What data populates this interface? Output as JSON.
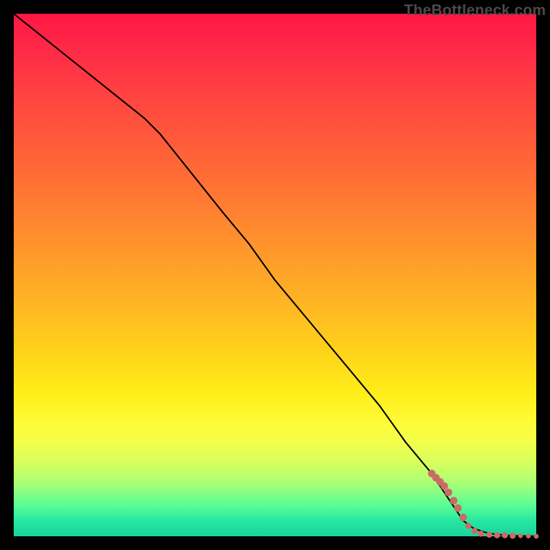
{
  "watermark": "TheBottleneck.com",
  "colors": {
    "frame": "#000000",
    "curve": "#000000",
    "dot": "#cc6b66"
  },
  "chart_data": {
    "type": "line",
    "title": "",
    "xlabel": "",
    "ylabel": "",
    "xlim": [
      0,
      100
    ],
    "ylim": [
      0,
      100
    ],
    "grid": false,
    "legend": false,
    "series": [
      {
        "name": "curve",
        "x": [
          0,
          5,
          10,
          15,
          20,
          25,
          28,
          32,
          36,
          40,
          45,
          50,
          55,
          60,
          65,
          70,
          75,
          80,
          84,
          86,
          88,
          90,
          92,
          94,
          96,
          98,
          100
        ],
        "y": [
          100,
          96,
          92,
          88,
          84,
          80,
          77,
          72,
          67,
          62,
          56,
          49,
          43,
          37,
          31,
          25,
          18,
          12,
          6,
          3,
          1.5,
          0.8,
          0.4,
          0.2,
          0.1,
          0.05,
          0
        ]
      }
    ],
    "scatter": {
      "name": "dots",
      "points": [
        {
          "x": 80.0,
          "y": 12.0,
          "r": 5
        },
        {
          "x": 80.8,
          "y": 11.2,
          "r": 5
        },
        {
          "x": 81.6,
          "y": 10.4,
          "r": 5
        },
        {
          "x": 82.4,
          "y": 9.6,
          "r": 5
        },
        {
          "x": 83.2,
          "y": 8.4,
          "r": 5
        },
        {
          "x": 84.2,
          "y": 6.8,
          "r": 5
        },
        {
          "x": 85.0,
          "y": 5.4,
          "r": 5
        },
        {
          "x": 86.0,
          "y": 3.6,
          "r": 5
        },
        {
          "x": 87.0,
          "y": 2.0,
          "r": 4
        },
        {
          "x": 88.2,
          "y": 1.0,
          "r": 4
        },
        {
          "x": 89.4,
          "y": 0.5,
          "r": 4
        },
        {
          "x": 91.0,
          "y": 0.3,
          "r": 4
        },
        {
          "x": 92.5,
          "y": 0.2,
          "r": 4
        },
        {
          "x": 94.0,
          "y": 0.2,
          "r": 4
        },
        {
          "x": 95.5,
          "y": 0.1,
          "r": 4
        },
        {
          "x": 97.0,
          "y": 0.1,
          "r": 3
        },
        {
          "x": 98.5,
          "y": 0.05,
          "r": 3
        },
        {
          "x": 100.0,
          "y": 0.0,
          "r": 3
        }
      ]
    }
  }
}
